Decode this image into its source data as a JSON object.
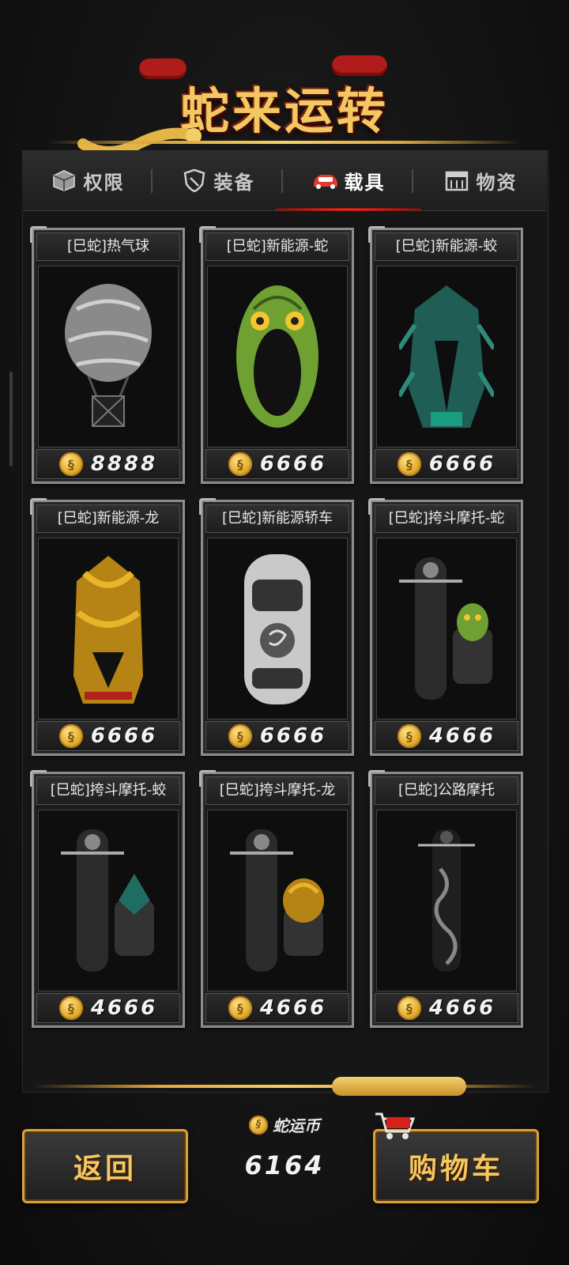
{
  "header": {
    "title": "蛇来运转"
  },
  "tabs": [
    {
      "label": "权限",
      "icon": "box-icon",
      "active": false
    },
    {
      "label": "装备",
      "icon": "shield-icon",
      "active": false
    },
    {
      "label": "载具",
      "icon": "car-icon",
      "active": true
    },
    {
      "label": "物资",
      "icon": "crate-icon",
      "active": false
    }
  ],
  "items": [
    {
      "name": "[巳蛇]热气球",
      "price": "8888",
      "art": "balloon"
    },
    {
      "name": "[巳蛇]新能源-蛇",
      "price": "6666",
      "art": "snake-car"
    },
    {
      "name": "[巳蛇]新能源-蛟",
      "price": "6666",
      "art": "jiao-car"
    },
    {
      "name": "[巳蛇]新能源-龙",
      "price": "6666",
      "art": "dragon-car"
    },
    {
      "name": "[巳蛇]新能源轿车",
      "price": "6666",
      "art": "sedan"
    },
    {
      "name": "[巳蛇]挎斗摩托-蛇",
      "price": "4666",
      "art": "sidecar-snake"
    },
    {
      "name": "[巳蛇]挎斗摩托-蛟",
      "price": "4666",
      "art": "sidecar-jiao"
    },
    {
      "name": "[巳蛇]挎斗摩托-龙",
      "price": "4666",
      "art": "sidecar-dragon"
    },
    {
      "name": "[巳蛇]公路摩托",
      "price": "4666",
      "art": "road-moto"
    }
  ],
  "footer": {
    "back_label": "返回",
    "currency_label": "蛇运币",
    "currency_value": "6164",
    "cart_label": "购物车"
  },
  "colors": {
    "gold": "#f3c761",
    "accent_red": "#d8201a"
  }
}
